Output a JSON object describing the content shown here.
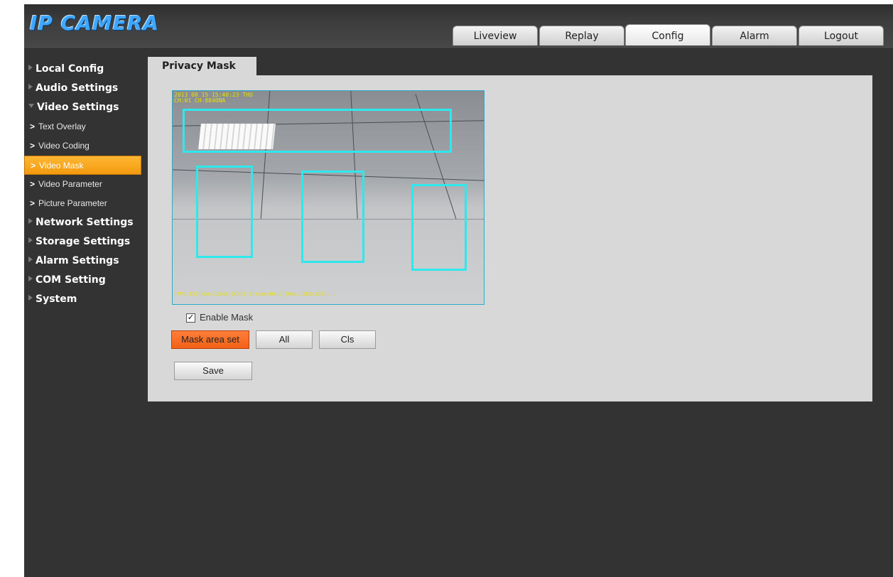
{
  "app": {
    "logo": "IP CAMERA"
  },
  "tabs": [
    {
      "label": "Liveview"
    },
    {
      "label": "Replay"
    },
    {
      "label": "Config",
      "active": true
    },
    {
      "label": "Alarm"
    },
    {
      "label": "Logout"
    }
  ],
  "sidebar": {
    "items": [
      {
        "label": "Local Config"
      },
      {
        "label": "Audio Settings"
      },
      {
        "label": "Video Settings",
        "expanded": true
      },
      {
        "label": "Network Settings"
      },
      {
        "label": "Storage Settings"
      },
      {
        "label": "Alarm Settings"
      },
      {
        "label": "COM Setting"
      },
      {
        "label": "System"
      }
    ],
    "sub_items": [
      {
        "label": "Text Overlay"
      },
      {
        "label": "Video Coding"
      },
      {
        "label": "Video Mask",
        "active": true
      },
      {
        "label": "Video Parameter"
      },
      {
        "label": "Picture Parameter"
      }
    ]
  },
  "main": {
    "tab_title": "Privacy Mask",
    "osd_line1": "2013 08 15 15:40:23 THU",
    "osd_line2": "CH:01 CH-8840NA",
    "osd_bottom": "[FPS:15][Kbps:2048][CH1][Stream:Main][Res:1280x720]...",
    "enable_mask_label": "Enable Mask",
    "enable_mask_checked": true,
    "mask_area_set_label": "Mask area set",
    "all_label": "All",
    "cls_label": "Cls",
    "save_label": "Save"
  },
  "colors": {
    "accent_orange": "#f39a0f",
    "mask_cyan": "#2ee8ee",
    "logo_blue": "#3fa7ff"
  }
}
